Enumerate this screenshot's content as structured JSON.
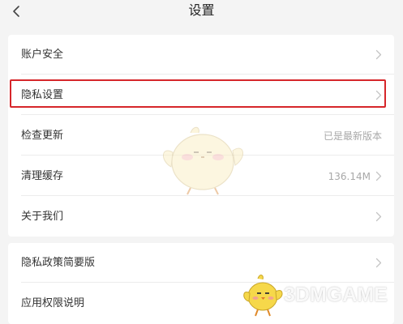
{
  "header": {
    "title": "设置",
    "back_icon": "chevron-left-icon"
  },
  "settings": {
    "card1": [
      {
        "label": "账户安全",
        "value": "",
        "chevron": true
      },
      {
        "label": "隐私设置",
        "value": "",
        "chevron": true
      },
      {
        "label": "检查更新",
        "value": "已是最新版本",
        "chevron": false
      },
      {
        "label": "清理缓存",
        "value": "136.14M",
        "chevron": true
      },
      {
        "label": "关于我们",
        "value": "",
        "chevron": true
      }
    ],
    "card2": [
      {
        "label": "隐私政策简要版",
        "value": "",
        "chevron": true
      },
      {
        "label": "应用权限说明",
        "value": "",
        "chevron": false
      }
    ]
  },
  "watermark": {
    "text": "3DMGAME"
  },
  "colors": {
    "highlight": "#d6262a",
    "background": "#f4f4f4",
    "card": "#ffffff"
  }
}
